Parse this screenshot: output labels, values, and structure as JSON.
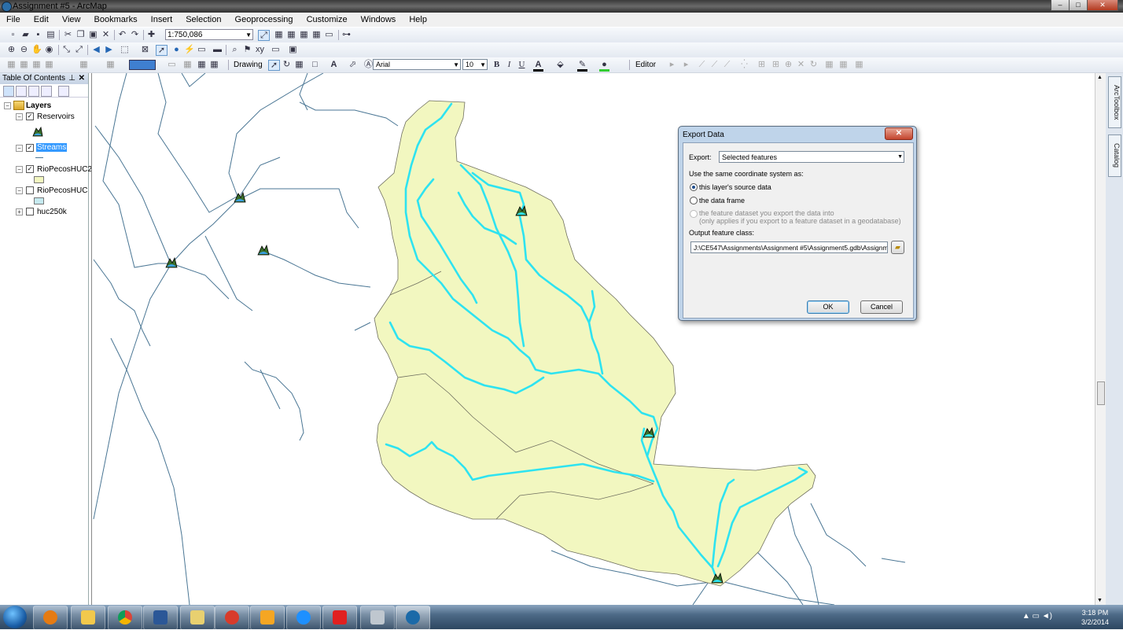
{
  "window": {
    "title": "Assignment #5 - ArcMap"
  },
  "menu": [
    "File",
    "Edit",
    "View",
    "Bookmarks",
    "Insert",
    "Selection",
    "Geoprocessing",
    "Customize",
    "Windows",
    "Help"
  ],
  "toolbar": {
    "scale": "1:750,086",
    "drawing_label": "Drawing",
    "font_name": "Arial",
    "font_size": "10",
    "bold": "B",
    "italic": "I",
    "underline": "U",
    "editor_label": "Editor"
  },
  "toc": {
    "title": "Table Of Contents",
    "root": "Layers",
    "layers": [
      {
        "name": "Reservoirs",
        "checked": true
      },
      {
        "name": "Streams",
        "checked": true,
        "selected": true
      },
      {
        "name": "RioPecosHUC2",
        "checked": true
      },
      {
        "name": "RioPecosHUC",
        "checked": false
      },
      {
        "name": "huc250k",
        "checked": false
      }
    ]
  },
  "side_tabs": {
    "toolbox": "ArcToolbox",
    "catalog": "Catalog"
  },
  "dialog": {
    "title": "Export Data",
    "export_label": "Export:",
    "export_value": "Selected features",
    "coord_label": "Use the same coordinate system as:",
    "option_source": "this layer's source data",
    "option_frame": "the data frame",
    "option_dataset": "the feature dataset you export the data into",
    "option_dataset_note": "(only applies if you export to a feature dataset in a geodatabase)",
    "output_label": "Output feature class:",
    "output_value": "J:\\CE547\\Assignments\\Assignment #5\\Assignment5.gdb\\Assignment",
    "ok": "OK",
    "cancel": "Cancel"
  },
  "clock": {
    "time": "3:18 PM",
    "date": "3/2/2014"
  },
  "colors": {
    "basin": "#f2f7c0",
    "stream": "#4a7694",
    "selected_stream": "#2ee3f0",
    "dialog_frame": "#bfd4ea"
  }
}
